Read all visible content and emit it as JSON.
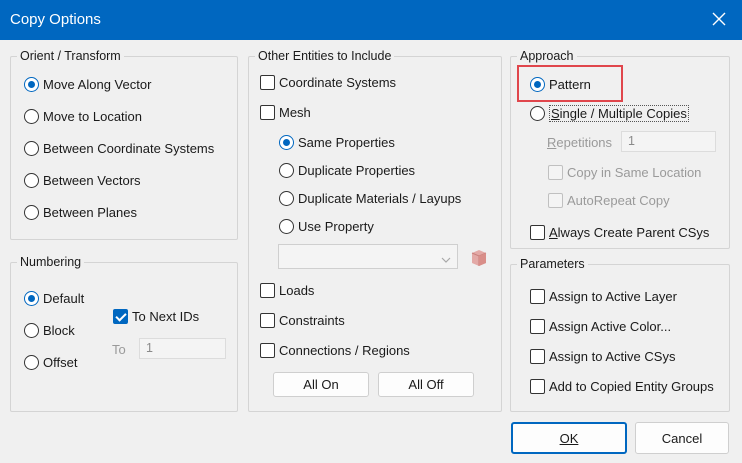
{
  "window": {
    "title": "Copy Options"
  },
  "orient": {
    "legend": "Orient / Transform",
    "options": [
      "Move Along Vector",
      "Move to Location",
      "Between Coordinate Systems",
      "Between Vectors",
      "Between Planes"
    ],
    "selected": 0
  },
  "numbering": {
    "legend": "Numbering",
    "options": [
      "Default",
      "Block",
      "Offset"
    ],
    "selected": 0,
    "to_next_ids": "To Next IDs",
    "to_label": "To",
    "to_value": "1"
  },
  "other": {
    "legend": "Other Entities to Include",
    "coord_systems": "Coordinate Systems",
    "mesh": "Mesh",
    "mesh_options": [
      "Same Properties",
      "Duplicate Properties",
      "Duplicate Materials / Layups",
      "Use Property"
    ],
    "mesh_selected": 0,
    "loads": "Loads",
    "constraints": "Constraints",
    "connections": "Connections / Regions",
    "all_on": "All On",
    "all_off": "All Off"
  },
  "approach": {
    "legend": "Approach",
    "pattern": "Pattern",
    "single_multiple_prefix": "S",
    "single_multiple_rest": "ingle / Multiple Copies",
    "repetitions_prefix": "R",
    "repetitions_rest": "epetitions",
    "repetitions_value": "1",
    "copy_same_location": "Copy in Same Location",
    "autorepeat": "AutoRepeat Copy",
    "always_parent_prefix": "A",
    "always_parent_rest": "lways Create Parent CSys"
  },
  "parameters": {
    "legend": "Parameters",
    "items": [
      "Assign to Active Layer",
      "Assign Active Color...",
      "Assign to Active CSys",
      "Add to Copied Entity Groups"
    ]
  },
  "buttons": {
    "ok": "OK",
    "cancel": "Cancel"
  },
  "colors": {
    "accent": "#0067c0",
    "highlight": "#e0464c"
  }
}
